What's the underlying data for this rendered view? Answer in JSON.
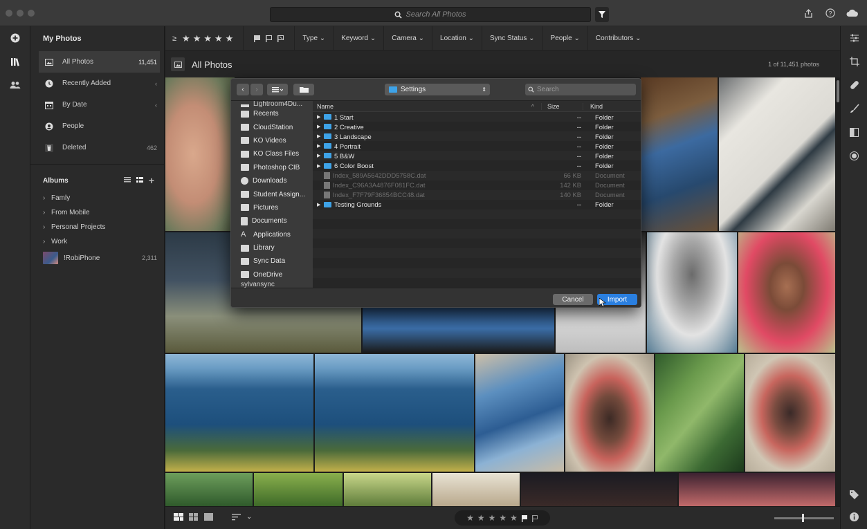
{
  "search": {
    "placeholder": "Search All Photos"
  },
  "sidebar": {
    "heading": "My Photos",
    "items": [
      {
        "label": "All Photos",
        "count": "11,451",
        "icon": "photos-icon"
      },
      {
        "label": "Recently Added",
        "count": "",
        "icon": "clock-icon"
      },
      {
        "label": "By Date",
        "count": "",
        "icon": "calendar-icon"
      },
      {
        "label": "People",
        "count": "",
        "icon": "person-icon"
      },
      {
        "label": "Deleted",
        "count": "462",
        "icon": "trash-icon"
      }
    ],
    "albums_heading": "Albums",
    "albums": [
      {
        "label": "Famly"
      },
      {
        "label": "From Mobile"
      },
      {
        "label": "Personal Projects"
      },
      {
        "label": "Work"
      }
    ],
    "mobile_album": {
      "label": "!RobiPhone",
      "count": "2,311"
    }
  },
  "filterbar": {
    "rating_op": "≥",
    "dropdowns": [
      "Type",
      "Keyword",
      "Camera",
      "Location",
      "Sync Status",
      "People",
      "Contributors"
    ]
  },
  "grid": {
    "title": "All Photos",
    "count_text": "1 of 11,451 photos"
  },
  "dialog": {
    "location": "Settings",
    "search_placeholder": "Search",
    "sidebar_items": [
      "Recents",
      "CloudStation",
      "KO Videos",
      "KO Class Files",
      "Photoshop CIB",
      "Downloads",
      "Student Assign...",
      "Pictures",
      "Documents",
      "Applications",
      "Library",
      "Sync Data",
      "OneDrive"
    ],
    "sidebar_cut_top": "Lightroom4Du...",
    "sidebar_cut_bottom": "sylvansync",
    "columns": {
      "name": "Name",
      "size": "Size",
      "kind": "Kind"
    },
    "rows": [
      {
        "name": "1 Start",
        "size": "--",
        "kind": "Folder",
        "type": "folder"
      },
      {
        "name": "2 Creative",
        "size": "--",
        "kind": "Folder",
        "type": "folder"
      },
      {
        "name": "3 Landscape",
        "size": "--",
        "kind": "Folder",
        "type": "folder"
      },
      {
        "name": "4 Portrait",
        "size": "--",
        "kind": "Folder",
        "type": "folder"
      },
      {
        "name": "5 B&W",
        "size": "--",
        "kind": "Folder",
        "type": "folder"
      },
      {
        "name": "6 Color Boost",
        "size": "--",
        "kind": "Folder",
        "type": "folder"
      },
      {
        "name": "Index_589A5642DDD5758C.dat",
        "size": "66 KB",
        "kind": "Document",
        "type": "doc"
      },
      {
        "name": "Index_C96A3A4876F081FC.dat",
        "size": "142 KB",
        "kind": "Document",
        "type": "doc"
      },
      {
        "name": "Index_F7F79F36854BCC48.dat",
        "size": "140 KB",
        "kind": "Document",
        "type": "doc"
      },
      {
        "name": "Testing Grounds",
        "size": "--",
        "kind": "Folder",
        "type": "folder"
      }
    ],
    "cancel_label": "Cancel",
    "import_label": "Import"
  },
  "colors": {
    "accent": "#2a7fe0",
    "folder": "#3ea3e8"
  }
}
